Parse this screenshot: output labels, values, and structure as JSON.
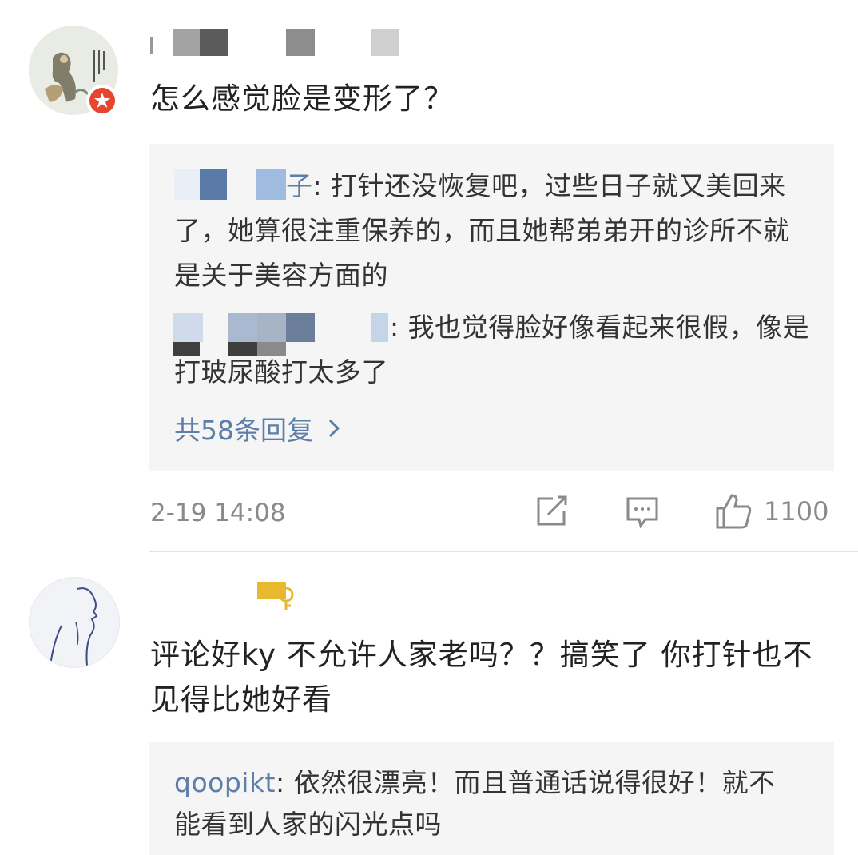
{
  "comment1": {
    "text": "怎么感觉脸是变形了？",
    "replies": [
      {
        "name_suffix": "子",
        "text": ": 打针还没恢复吧，过些日子就又美回来了，她算很注重保养的，而且她帮弟弟开的诊所不就是关于美容方面的"
      },
      {
        "text": ": 我也觉得脸好像看起来很假，像是打玻尿酸打太多了"
      }
    ],
    "more_replies": "共58条回复",
    "timestamp": "2-19 14:08",
    "like_count": "1100",
    "icons": {
      "repost": "repost-icon",
      "comment": "comment-icon",
      "like": "thumbs-up-icon",
      "more": "chevron-right-icon"
    }
  },
  "comment2": {
    "text": "评论好ky 不允许人家老吗？？搞笑了 你打针也不见得比她好看",
    "reply": {
      "name": "qoopikt",
      "text": ": 依然很漂亮！而且普通话说得很好！就不能看到人家的闪光点吗"
    }
  },
  "colors": {
    "link": "#5b7fa8",
    "reply_bg": "#f5f5f5",
    "meta": "#8a8a8a",
    "badge_red": "#e6452f",
    "badge_gold": "#e8b92e"
  }
}
